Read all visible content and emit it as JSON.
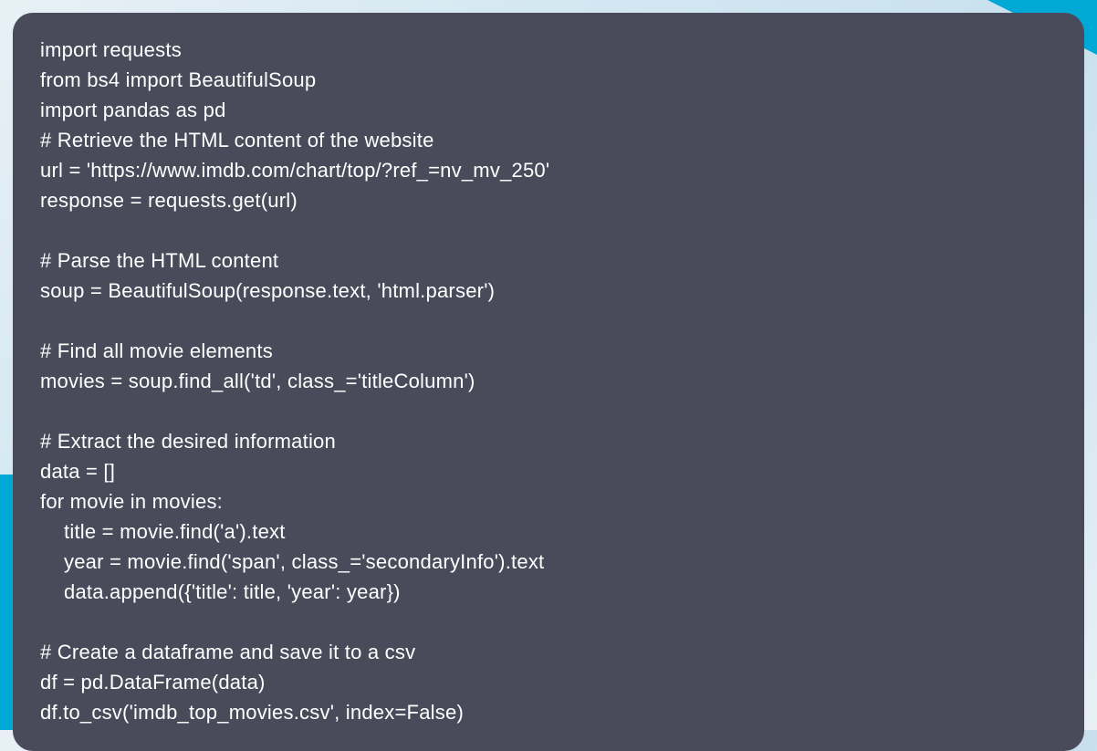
{
  "code": {
    "lines": [
      "import requests",
      "from bs4 import BeautifulSoup",
      "import pandas as pd",
      "# Retrieve the HTML content of the website",
      "url = 'https://www.imdb.com/chart/top/?ref_=nv_mv_250'",
      "response = requests.get(url)",
      "",
      "# Parse the HTML content",
      "soup = BeautifulSoup(response.text, 'html.parser')",
      "",
      "# Find all movie elements",
      "movies = soup.find_all('td', class_='titleColumn')",
      "",
      "# Extract the desired information",
      "data = []",
      "for movie in movies:",
      "    title = movie.find('a').text",
      "    year = movie.find('span', class_='secondaryInfo').text",
      "    data.append({'title': title, 'year': year})",
      "",
      "# Create a dataframe and save it to a csv",
      "df = pd.DataFrame(data)",
      "df.to_csv('imdb_top_movies.csv', index=False)"
    ]
  },
  "colors": {
    "code_bg": "#4a4b5a",
    "code_fg": "#ffffff",
    "accent": "#00a8d6"
  }
}
